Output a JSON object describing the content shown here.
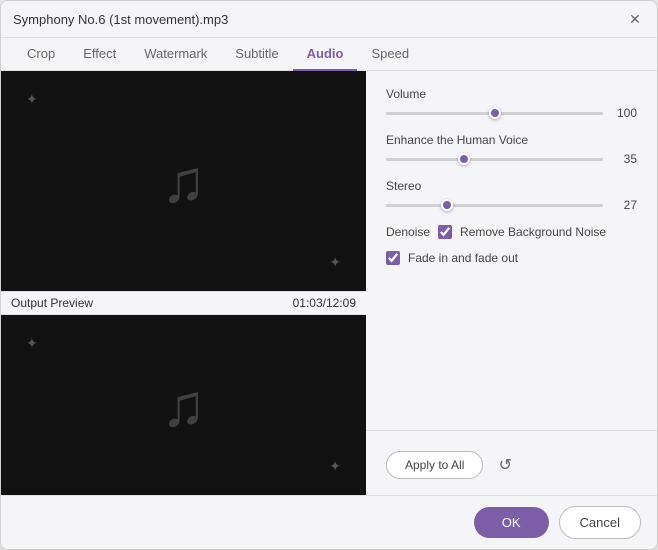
{
  "titlebar": {
    "title": "Symphony No.6 (1st movement).mp3",
    "close_label": "✕"
  },
  "tabs": [
    {
      "label": "Crop",
      "active": false
    },
    {
      "label": "Effect",
      "active": false
    },
    {
      "label": "Watermark",
      "active": false
    },
    {
      "label": "Subtitle",
      "active": false
    },
    {
      "label": "Audio",
      "active": true
    },
    {
      "label": "Speed",
      "active": false
    }
  ],
  "preview": {
    "output_label": "Output Preview",
    "timestamp": "01:03/12:09"
  },
  "controls": {
    "volume_label": "Volume",
    "volume_value": "100",
    "volume_pct": 100,
    "enhance_label": "Enhance the Human Voice",
    "enhance_value": "35",
    "enhance_pct": 35,
    "stereo_label": "Stereo",
    "stereo_value": "27",
    "stereo_pct": 27,
    "denoise_label": "Denoise",
    "remove_bg_label": "Remove Background Noise",
    "fade_label": "Fade in and fade out"
  },
  "buttons": {
    "apply_all": "Apply to All",
    "ok": "OK",
    "cancel": "Cancel",
    "refresh_icon": "↺"
  },
  "icons": {
    "music_note": "♫",
    "play_prev": "◀",
    "play_pause": "⏸",
    "play_next": "▶",
    "sparkle": "✦"
  }
}
